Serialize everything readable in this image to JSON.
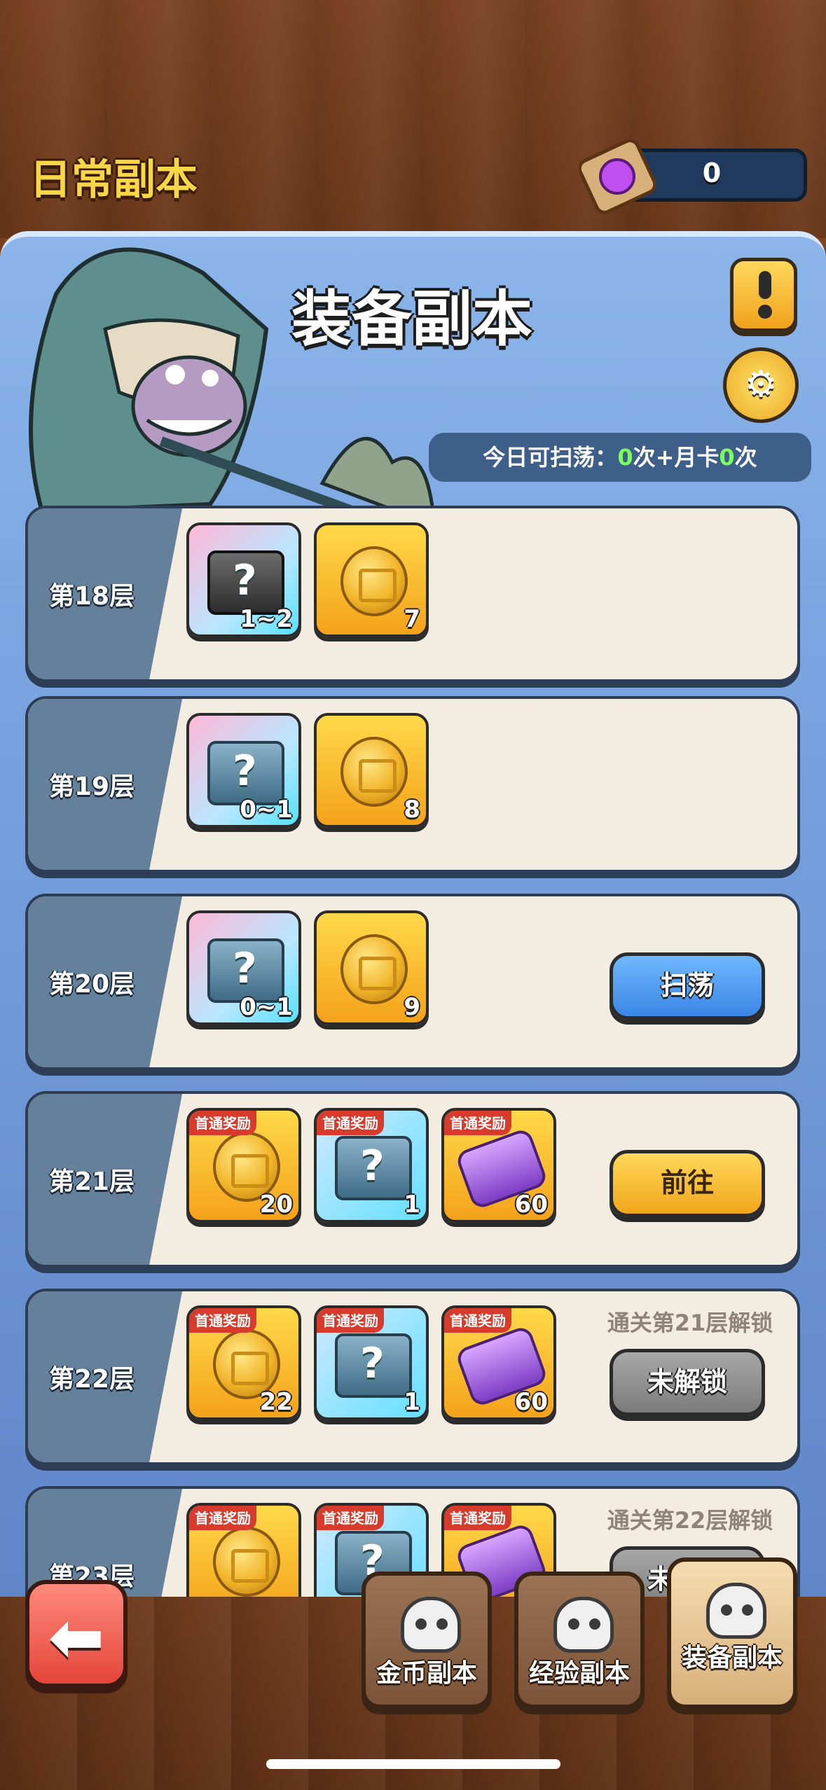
{
  "header": {
    "title": "日常副本",
    "scroll_count": "0"
  },
  "banner": {
    "title": "装备副本",
    "sweep_prefix": "今日可扫荡：",
    "sweep_count": "0",
    "sweep_mid": "次+月卡",
    "card_count": "0",
    "sweep_suffix": "次"
  },
  "floors": [
    {
      "label": "第18层",
      "items": [
        {
          "type": "dark-chest",
          "count": "1~2"
        },
        {
          "type": "coin",
          "count": "7"
        }
      ]
    },
    {
      "label": "第19层",
      "items": [
        {
          "type": "chest",
          "count": "0~1"
        },
        {
          "type": "coin",
          "count": "8"
        }
      ]
    },
    {
      "label": "第20层",
      "items": [
        {
          "type": "chest",
          "count": "0~1"
        },
        {
          "type": "coin",
          "count": "9"
        }
      ],
      "button": "扫荡"
    },
    {
      "label": "第21层",
      "items": [
        {
          "type": "coin",
          "count": "20",
          "tag": "首通奖励"
        },
        {
          "type": "chest",
          "count": "1",
          "tag": "首通奖励"
        },
        {
          "type": "fragment",
          "count": "60",
          "tag": "首通奖励"
        }
      ],
      "button": "前往"
    },
    {
      "label": "第22层",
      "items": [
        {
          "type": "coin",
          "count": "22",
          "tag": "首通奖励"
        },
        {
          "type": "chest",
          "count": "1",
          "tag": "首通奖励"
        },
        {
          "type": "fragment",
          "count": "60",
          "tag": "首通奖励"
        }
      ],
      "button": "未解锁",
      "hint": "通关第21层解锁"
    },
    {
      "label": "第23层",
      "items": [
        {
          "type": "coin",
          "count": "",
          "tag": "首通奖励"
        },
        {
          "type": "chest",
          "count": "",
          "tag": "首通奖励"
        },
        {
          "type": "fragment",
          "count": "",
          "tag": "首通奖励"
        }
      ],
      "button": "未解锁",
      "hint": "通关第22层解锁"
    }
  ],
  "tabs": [
    {
      "label": "金币副本",
      "icon": "skull-coin-icon"
    },
    {
      "label": "经验副本",
      "icon": "skull-exp-icon"
    },
    {
      "label": "装备副本",
      "icon": "skull-equip-icon"
    }
  ],
  "colors": {
    "title_yellow": "#f7d648",
    "panel_blue": "#7aa5e0",
    "sweep_green": "#7cff5c"
  }
}
